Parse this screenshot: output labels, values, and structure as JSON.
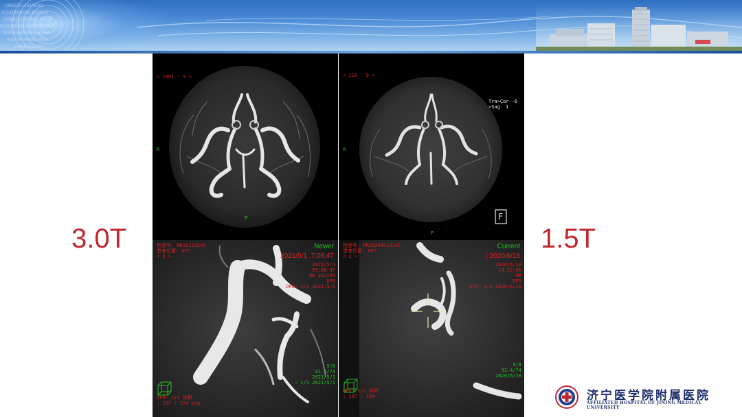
{
  "labels": {
    "left_field": "3.0T",
    "right_field": "1.5T"
  },
  "panels": {
    "top_left": {
      "index": "< 1001 - 5 >",
      "orientation_left": "R",
      "orientation_bottom": "P"
    },
    "top_right": {
      "index": "< 116 - 5 >",
      "orientation_left": "R",
      "orientation_bottom": "P",
      "view_info": "Tra>Cor -6\n>Sag  1",
      "marker": "F"
    },
    "bottom_left": {
      "header_left": "检查号: MR20210509\n患者位置: HFS\n< 3 >",
      "status": "Newer",
      "datetime": "2021/5/1 ,7:06:47",
      "right_info": "2021/5/1\n07:06:47\nMR 202105\nDPO\nDPO: 1/s 2021/5/1",
      "bottom_left_info": "DPO: 1/s 体积\n: 107 / 154 eng",
      "bottom_right_info": "9/8\n91.4/74\n2021/5/1\n: 1/1 2021/5/1"
    },
    "bottom_right": {
      "header_left": "检查号: MR20200618345\n患者位置: HFS\n< 2 >",
      "status": "Current",
      "datetime": "[ 2020/6/18",
      "right_info": "2020/6/18\n14:22:06\nMR\nDPO\nDPO: 1/s 2020/6/18",
      "bottom_left_info": "DPO: 1/s 体积\n: 107 / 154",
      "bottom_right_info": "9/8\n91.4/74\n2020/6/18"
    }
  },
  "logo": {
    "chinese_name": "济宁医学院附属医院",
    "english_name": "AFFILIATED HOSPITAL OF JINING MEDICAL UNIVERSITY"
  },
  "colors": {
    "label_red": "#c0262e",
    "banner_blue": "#3d7ccb",
    "overlay_red": "#d42020",
    "overlay_green": "#22c022",
    "logo_navy": "#1f2f6e"
  },
  "icons": {
    "logo_mark": "hospital-emblem-icon",
    "crosshair": "crosshair-icon",
    "orientation_cube": "orientation-cube-icon"
  }
}
